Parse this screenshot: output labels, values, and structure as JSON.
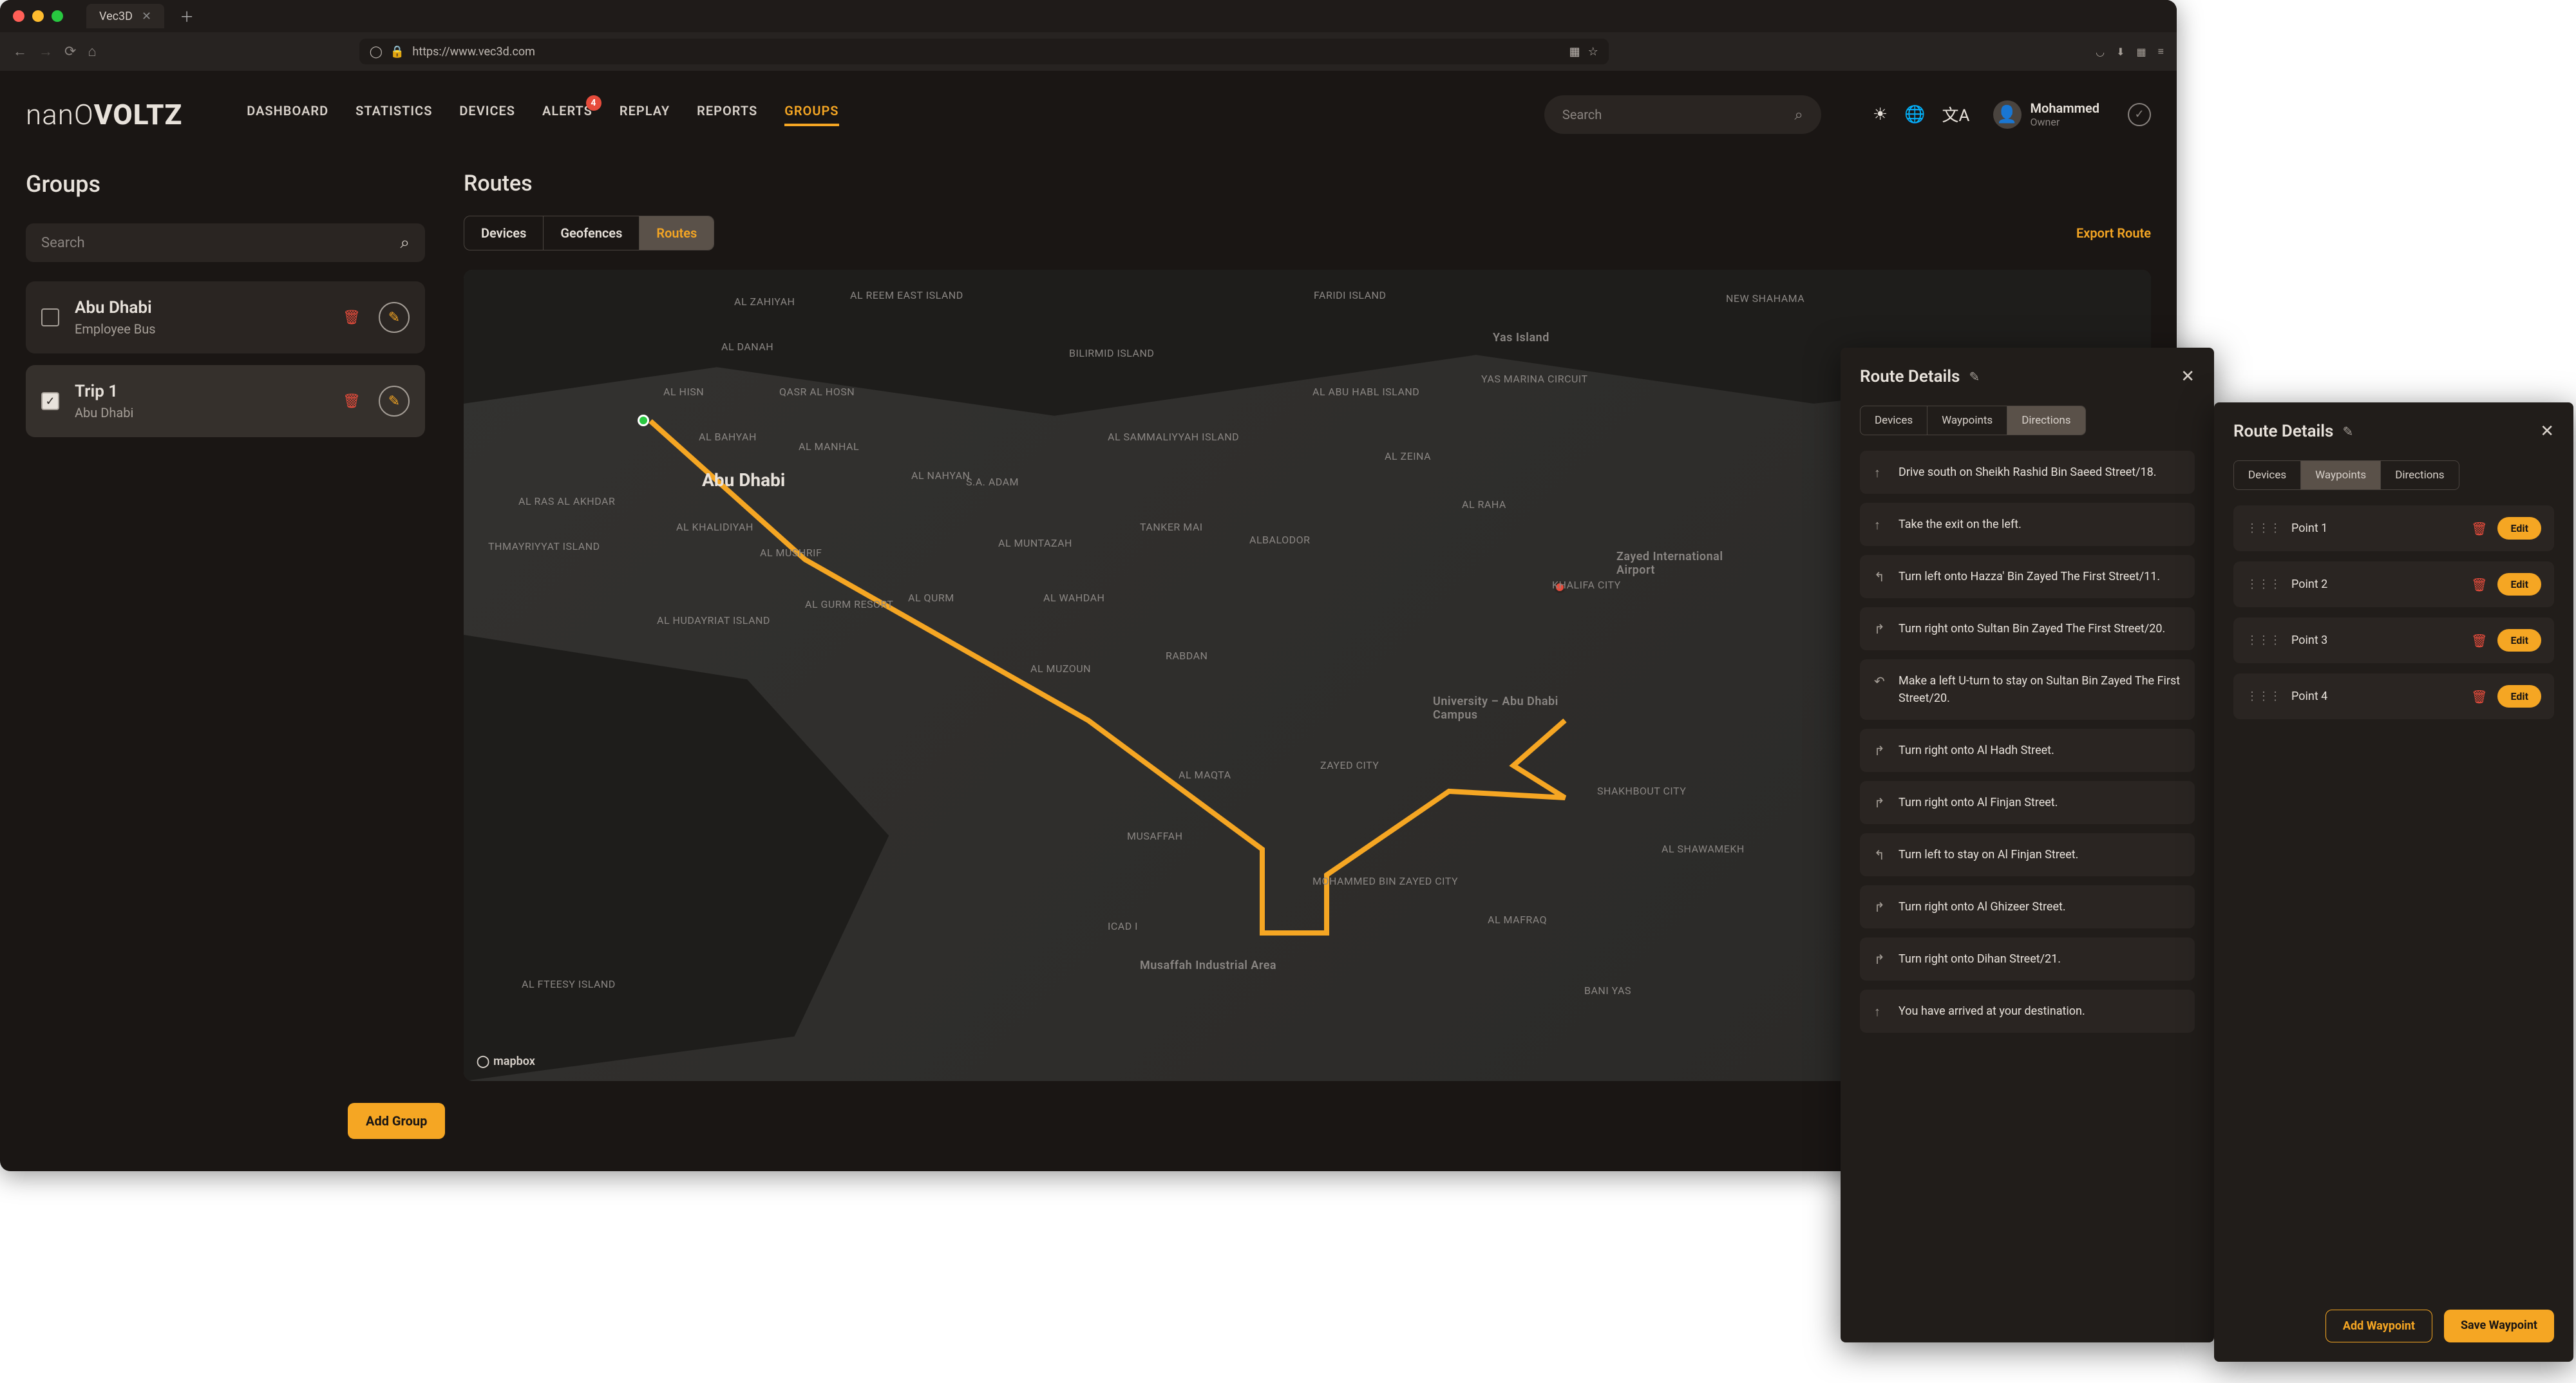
{
  "browser": {
    "tab_title": "Vec3D",
    "url": "https://www.vec3d.com"
  },
  "logo": {
    "part1": "nanO",
    "part2": "VOLTZ"
  },
  "nav": {
    "items": [
      "DASHBOARD",
      "STATISTICS",
      "DEVICES",
      "ALERTS",
      "REPLAY",
      "REPORTS",
      "GROUPS"
    ],
    "active": "GROUPS",
    "alerts_badge": "4"
  },
  "header": {
    "search_placeholder": "Search",
    "user_name": "Mohammed",
    "user_role": "Owner"
  },
  "sidebar": {
    "title": "Groups",
    "search_placeholder": "Search",
    "add_btn": "Add Group",
    "items": [
      {
        "title": "Abu Dhabi",
        "sub": "Employee Bus",
        "checked": false
      },
      {
        "title": "Trip 1",
        "sub": "Abu Dhabi",
        "checked": true
      }
    ]
  },
  "content": {
    "title": "Routes",
    "tabs": [
      "Devices",
      "Geofences",
      "Routes"
    ],
    "tab_active": "Routes",
    "export": "Export Route",
    "map_big_label": "Abu Dhabi",
    "mapbox": "mapbox",
    "places": [
      "AL ZAHIYAH",
      "AL REEM EAST ISLAND",
      "BILIRMID ISLAND",
      "AL DANAH",
      "AL HISN",
      "QASR AL HOSN",
      "FARIDI ISLAND",
      "Yas Island",
      "Yas Marina Circuit",
      "NEW SHAHAMA",
      "AL BAHYAH",
      "AL RAS AL AKHDAR",
      "THMAYRIYYAT ISLAND",
      "AL KHALIDIYAH",
      "AL MANHAL",
      "AL NAHYAN",
      "S.A. ADAM",
      "AL SAMMALIYYAH ISLAND",
      "AL ZEINA",
      "AL ABU HABL ISLAND",
      "AL MUSHRIF",
      "AL MUNTAZAH",
      "TANKER MAI",
      "AL RAHA",
      "ALBALODOR",
      "AL HUDAYRIAT ISLAND",
      "AL GURM RESORT",
      "AL QURM",
      "AL MUZOUN",
      "RABDAN",
      "KHALIFA CITY",
      "AL WAHDAH",
      "University – Abu Dhabi Campus",
      "Zayed International Airport",
      "ZAYED CITY",
      "AL MAQTA",
      "SHAKHBOUT CITY",
      "MUSAFFAH",
      "AL SHAWAMEKH",
      "MOHAMMED BIN ZAYED CITY",
      "ICAD I",
      "AL MAFRAQ",
      "BANI YAS",
      "Musaffah Industrial Area",
      "AL FTEESY ISLAND"
    ]
  },
  "panel1": {
    "title": "Route Details",
    "tabs": [
      "Devices",
      "Waypoints",
      "Directions"
    ],
    "active": "Directions",
    "steps": [
      {
        "icon": "↑",
        "text": "Drive south on Sheikh Rashid Bin Saeed Street/18."
      },
      {
        "icon": "↑",
        "text": "Take the exit on the left."
      },
      {
        "icon": "↰",
        "text": "Turn left onto Hazza' Bin Zayed The First Street/11."
      },
      {
        "icon": "↱",
        "text": "Turn right onto Sultan Bin Zayed The First Street/20."
      },
      {
        "icon": "↶",
        "text": "Make a left U-turn to stay on Sultan Bin Zayed The First Street/20."
      },
      {
        "icon": "↱",
        "text": "Turn right onto Al Hadh Street."
      },
      {
        "icon": "↱",
        "text": "Turn right onto Al Finjan Street."
      },
      {
        "icon": "↰",
        "text": "Turn left to stay on Al Finjan Street."
      },
      {
        "icon": "↱",
        "text": "Turn right onto Al Ghizeer Street."
      },
      {
        "icon": "↱",
        "text": "Turn right onto Dihan Street/21."
      },
      {
        "icon": "↑",
        "text": "You have arrived at your destination."
      }
    ]
  },
  "panel2": {
    "title": "Route Details",
    "tabs": [
      "Devices",
      "Waypoints",
      "Directions"
    ],
    "active": "Waypoints",
    "edit_label": "Edit",
    "add_btn": "Add Waypoint",
    "save_btn": "Save Waypoint",
    "waypoints": [
      "Point 1",
      "Point 2",
      "Point 3",
      "Point 4"
    ]
  }
}
